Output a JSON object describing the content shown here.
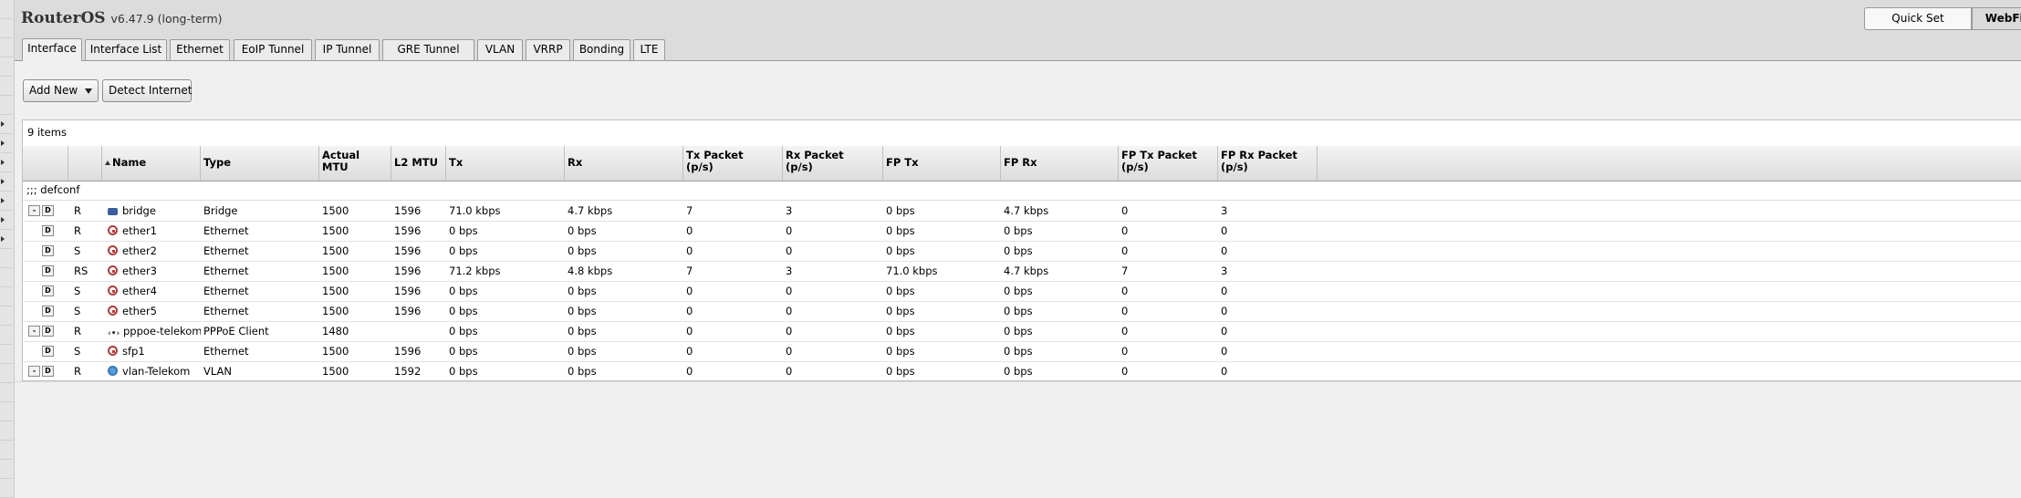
{
  "header": {
    "brand": "RouterOS",
    "version": "v6.47.9 (long-term)",
    "quick_set": "Quick Set",
    "webfig": "WebFig"
  },
  "tabs": [
    "Interface",
    "Interface List",
    "Ethernet",
    "EoIP Tunnel",
    "IP Tunnel",
    "GRE Tunnel",
    "VLAN",
    "VRRP",
    "Bonding",
    "LTE"
  ],
  "toolbar": {
    "add_new": "Add New",
    "detect_internet": "Detect Internet"
  },
  "grid": {
    "count": "9 items",
    "comment": ";;; defconf",
    "columns": [
      "Name",
      "Type",
      "Actual MTU",
      "L2 MTU",
      "Tx",
      "Rx",
      "Tx Packet (p/s)",
      "Rx Packet (p/s)",
      "FP Tx",
      "FP Rx",
      "FP Tx Packet (p/s)",
      "FP Rx Packet (p/s)"
    ],
    "rows": [
      {
        "minus": "-",
        "d": "D",
        "flags": "R",
        "icon": "bridge-icon",
        "name": "bridge",
        "type": "Bridge",
        "amtu": "1500",
        "l2mtu": "1596",
        "tx": "71.0 kbps",
        "rx": "4.7 kbps",
        "txp": "7",
        "rxp": "3",
        "fptx": "0 bps",
        "fprx": "4.7 kbps",
        "fptxp": "0",
        "fprxp": "3"
      },
      {
        "minus": "",
        "d": "D",
        "flags": "R",
        "icon": "ethernet-icon",
        "name": "ether1",
        "type": "Ethernet",
        "amtu": "1500",
        "l2mtu": "1596",
        "tx": "0 bps",
        "rx": "0 bps",
        "txp": "0",
        "rxp": "0",
        "fptx": "0 bps",
        "fprx": "0 bps",
        "fptxp": "0",
        "fprxp": "0"
      },
      {
        "minus": "",
        "d": "D",
        "flags": "S",
        "icon": "ethernet-icon",
        "name": "ether2",
        "type": "Ethernet",
        "amtu": "1500",
        "l2mtu": "1596",
        "tx": "0 bps",
        "rx": "0 bps",
        "txp": "0",
        "rxp": "0",
        "fptx": "0 bps",
        "fprx": "0 bps",
        "fptxp": "0",
        "fprxp": "0"
      },
      {
        "minus": "",
        "d": "D",
        "flags": "RS",
        "icon": "ethernet-icon",
        "name": "ether3",
        "type": "Ethernet",
        "amtu": "1500",
        "l2mtu": "1596",
        "tx": "71.2 kbps",
        "rx": "4.8 kbps",
        "txp": "7",
        "rxp": "3",
        "fptx": "71.0 kbps",
        "fprx": "4.7 kbps",
        "fptxp": "7",
        "fprxp": "3"
      },
      {
        "minus": "",
        "d": "D",
        "flags": "S",
        "icon": "ethernet-icon",
        "name": "ether4",
        "type": "Ethernet",
        "amtu": "1500",
        "l2mtu": "1596",
        "tx": "0 bps",
        "rx": "0 bps",
        "txp": "0",
        "rxp": "0",
        "fptx": "0 bps",
        "fprx": "0 bps",
        "fptxp": "0",
        "fprxp": "0"
      },
      {
        "minus": "",
        "d": "D",
        "flags": "S",
        "icon": "ethernet-icon",
        "name": "ether5",
        "type": "Ethernet",
        "amtu": "1500",
        "l2mtu": "1596",
        "tx": "0 bps",
        "rx": "0 bps",
        "txp": "0",
        "rxp": "0",
        "fptx": "0 bps",
        "fprx": "0 bps",
        "fptxp": "0",
        "fprxp": "0"
      },
      {
        "minus": "-",
        "d": "D",
        "flags": "R",
        "icon": "pppoe-icon",
        "name": "pppoe-telekom",
        "type": "PPPoE Client",
        "amtu": "1480",
        "l2mtu": "",
        "tx": "0 bps",
        "rx": "0 bps",
        "txp": "0",
        "rxp": "0",
        "fptx": "0 bps",
        "fprx": "0 bps",
        "fptxp": "0",
        "fprxp": "0"
      },
      {
        "minus": "",
        "d": "D",
        "flags": "S",
        "icon": "ethernet-icon",
        "name": "sfp1",
        "type": "Ethernet",
        "amtu": "1500",
        "l2mtu": "1596",
        "tx": "0 bps",
        "rx": "0 bps",
        "txp": "0",
        "rxp": "0",
        "fptx": "0 bps",
        "fprx": "0 bps",
        "fptxp": "0",
        "fprxp": "0"
      },
      {
        "minus": "-",
        "d": "D",
        "flags": "R",
        "icon": "vlan-icon",
        "name": "vlan-Telekom",
        "type": "VLAN",
        "amtu": "1500",
        "l2mtu": "1592",
        "tx": "0 bps",
        "rx": "0 bps",
        "txp": "0",
        "rxp": "0",
        "fptx": "0 bps",
        "fprx": "0 bps",
        "fptxp": "0",
        "fprxp": "0"
      }
    ]
  }
}
